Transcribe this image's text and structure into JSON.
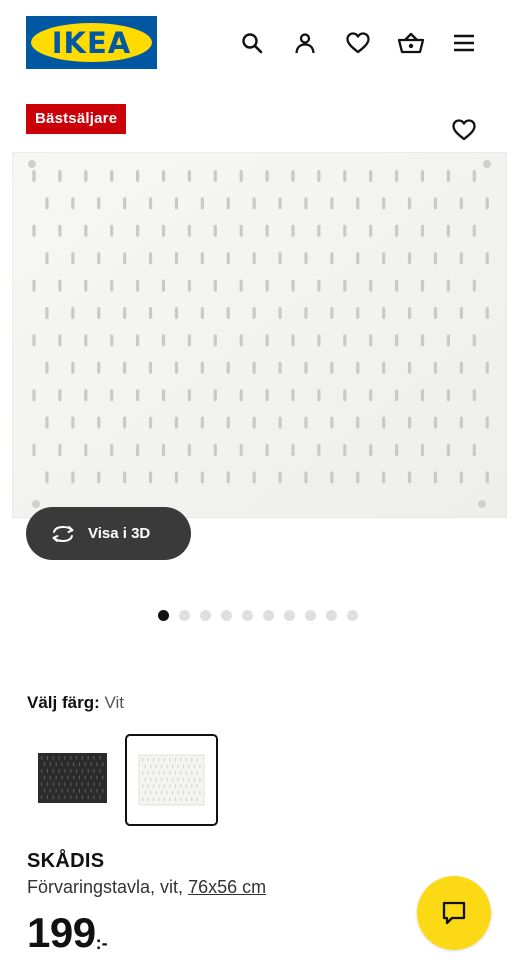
{
  "header": {
    "logo_text": "IKEA",
    "icons": [
      "search-icon",
      "user-icon",
      "heart-icon",
      "basket-icon",
      "menu-icon"
    ],
    "brand_colors": {
      "blue": "#0058a3",
      "yellow": "#ffdb00"
    }
  },
  "product": {
    "badge": "Bästsäljare",
    "badge_color": "#cc0008",
    "view_3d_label": "Visa i 3D",
    "carousel": {
      "total_images": 10,
      "active_index": 1
    },
    "color_picker": {
      "label": "Välj färg:",
      "selected": "Vit",
      "options": [
        {
          "name": "svart",
          "swatch_color": "#2b2b2b",
          "selected": false
        },
        {
          "name": "vit",
          "swatch_color": "#f4f4f1",
          "selected": true
        }
      ]
    },
    "name": "SKÅDIS",
    "description": "Förvaringstavla, vit,",
    "size": "76x56 cm",
    "price": "199",
    "price_suffix": ":-"
  },
  "chat": {
    "icon": "chat-icon",
    "color": "#fbd914"
  }
}
